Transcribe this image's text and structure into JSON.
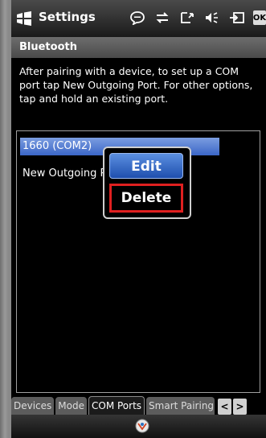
{
  "title_bar": {
    "app_title": "Settings",
    "ok_label": "OK"
  },
  "section": {
    "title": "Bluetooth"
  },
  "instructions": "After pairing with a device, to set up a COM port tap New Outgoing Port. For other options, tap and hold an existing port.",
  "ports_list": {
    "items": [
      {
        "label": "1660 (COM2)"
      },
      {
        "label": "New Outgoing Port"
      }
    ]
  },
  "context_menu": {
    "edit_label": "Edit",
    "delete_label": "Delete"
  },
  "tabs": [
    {
      "label": "Devices"
    },
    {
      "label": "Mode"
    },
    {
      "label": "COM Ports"
    },
    {
      "label": "Smart Pairing"
    }
  ],
  "tab_scroll": {
    "left": "<",
    "right": ">"
  },
  "colors": {
    "selection": "#3b66c7",
    "delete_highlight": "#e02020"
  },
  "icons": [
    "windows-logo-icon",
    "chat-icon",
    "sync-icon",
    "signal-icon",
    "speaker-icon",
    "battery-icon",
    "keyboard-icon"
  ]
}
